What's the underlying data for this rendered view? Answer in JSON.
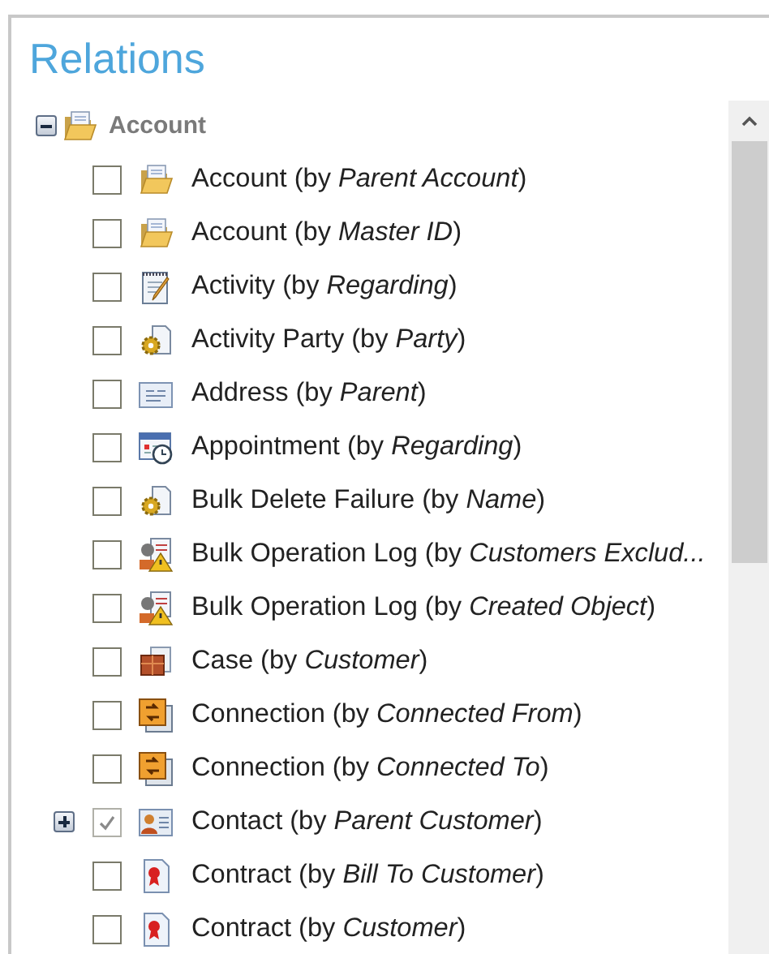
{
  "title": "Relations",
  "tree": {
    "label": "Account",
    "kind": "folder",
    "expanded": true,
    "children": [
      {
        "label": "Account (by *Parent Account*)",
        "kind": "folder",
        "checked": false,
        "has_children": false
      },
      {
        "label": "Account (by *Master ID*)",
        "kind": "folder",
        "checked": false,
        "has_children": false
      },
      {
        "label": "Activity (by *Regarding*)",
        "kind": "note",
        "checked": false,
        "has_children": false
      },
      {
        "label": "Activity Party (by *Party*)",
        "kind": "gear",
        "checked": false,
        "has_children": false
      },
      {
        "label": "Address (by *Parent*)",
        "kind": "address",
        "checked": false,
        "has_children": false
      },
      {
        "label": "Appointment (by *Regarding*)",
        "kind": "calendar",
        "checked": false,
        "has_children": false
      },
      {
        "label": "Bulk Delete Failure (by *Name*)",
        "kind": "gear",
        "checked": false,
        "has_children": false
      },
      {
        "label": "Bulk Operation Log (by *Customers Exclud...*",
        "kind": "log",
        "checked": false,
        "has_children": false
      },
      {
        "label": "Bulk Operation Log (by *Created Object*)",
        "kind": "log",
        "checked": false,
        "has_children": false
      },
      {
        "label": "Case (by *Customer*)",
        "kind": "case",
        "checked": false,
        "has_children": false
      },
      {
        "label": "Connection (by *Connected From*)",
        "kind": "connection",
        "checked": false,
        "has_children": false
      },
      {
        "label": "Connection (by *Connected To*)",
        "kind": "connection",
        "checked": false,
        "has_children": false
      },
      {
        "label": "Contact (by *Parent Customer*)",
        "kind": "contact",
        "checked": true,
        "has_children": true
      },
      {
        "label": "Contract (by *Bill To Customer*)",
        "kind": "contract",
        "checked": false,
        "has_children": false
      },
      {
        "label": "Contract (by *Customer*)",
        "kind": "contract",
        "checked": false,
        "has_children": false
      }
    ]
  }
}
